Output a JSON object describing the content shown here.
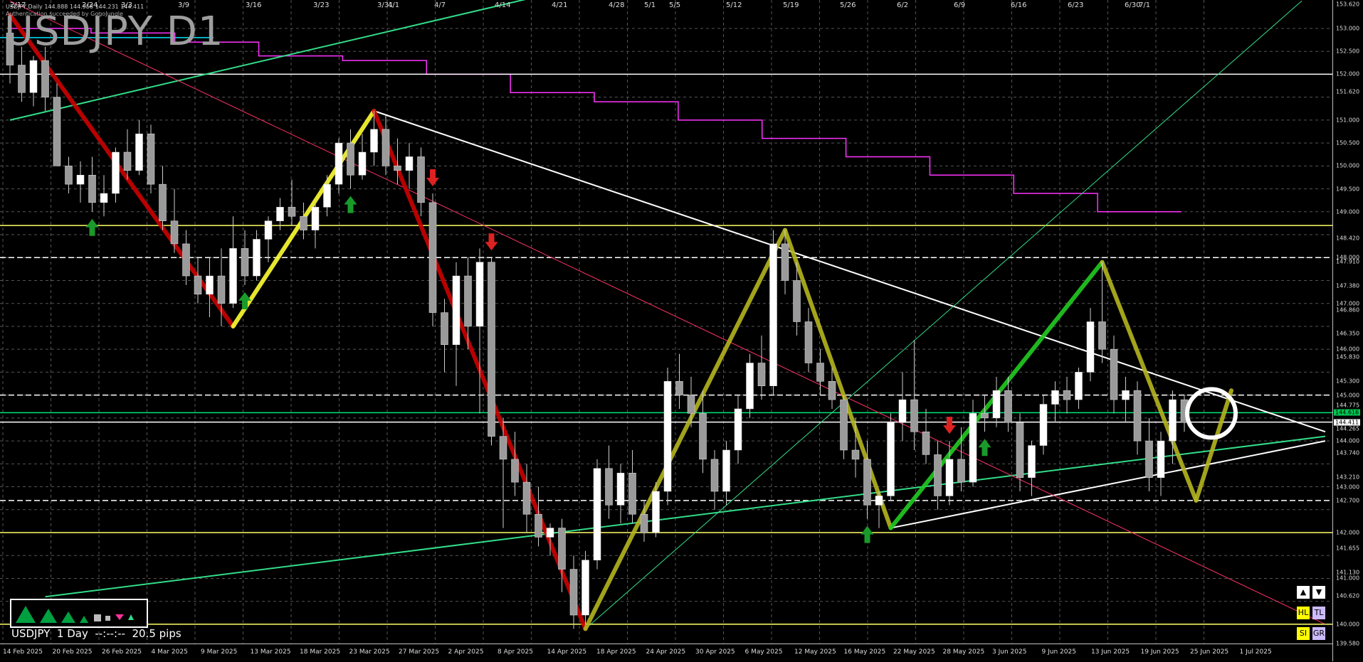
{
  "chart_data": {
    "type": "candlestick",
    "title": "USDJPY D1",
    "header_info": "USDJPY,Daily 144.888 144.958 144.231 144.411",
    "header_info2": "Authentication succeeded by GogoJungle",
    "status": "USDJPY  1 Day  --:--:--  20.5 pips",
    "price_axis": {
      "min": 139.58,
      "max": 153.62,
      "ticks": [
        "153.620",
        "153.000",
        "152.500",
        "152.000",
        "151.620",
        "151.000",
        "150.500",
        "150.000",
        "149.500",
        "149.000",
        "148.420",
        "148.000",
        "147.910",
        "147.380",
        "147.000",
        "146.860",
        "146.350",
        "146.000",
        "145.830",
        "145.300",
        "145.000",
        "144.775",
        "144.265",
        "144.000",
        "143.740",
        "143.210",
        "143.000",
        "142.700",
        "142.000",
        "141.655",
        "141.130",
        "141.000",
        "140.620",
        "140.000",
        "139.580"
      ],
      "current_price": "144.411",
      "green_line_price": "144.616"
    },
    "time_axis_bottom": [
      "14 Feb 2025",
      "20 Feb 2025",
      "26 Feb 2025",
      "4 Mar 2025",
      "9 Mar 2025",
      "13 Mar 2025",
      "18 Mar 2025",
      "23 Mar 2025",
      "27 Mar 2025",
      "2 Apr 2025",
      "8 Apr 2025",
      "14 Apr 2025",
      "18 Apr 2025",
      "24 Apr 2025",
      "30 Apr 2025",
      "6 May 2025",
      "12 May 2025",
      "16 May 2025",
      "22 May 2025",
      "28 May 2025",
      "3 Jun 2025",
      "9 Jun 2025",
      "13 Jun 2025",
      "19 Jun 2025",
      "25 Jun 2025",
      "1 Jul 2025"
    ],
    "time_axis_top": [
      "2/17",
      "2/24",
      "3/3",
      "3/9",
      "3/16",
      "3/23",
      "3/31",
      "4/1",
      "4/7",
      "4/14",
      "4/21",
      "4/28",
      "5/1",
      "5/5",
      "5/12",
      "5/19",
      "5/26",
      "6/2",
      "6/9",
      "6/16",
      "6/23",
      "6/30",
      "7/1"
    ],
    "horizontal_levels": [
      {
        "price": 152.0,
        "color": "#ffffff",
        "style": "solid"
      },
      {
        "price": 148.7,
        "color": "#ffff66",
        "style": "solid"
      },
      {
        "price": 148.0,
        "color": "#ffffff",
        "style": "dashed"
      },
      {
        "price": 145.0,
        "color": "#ffffff",
        "style": "dashed"
      },
      {
        "price": 144.616,
        "color": "#00e676",
        "style": "solid"
      },
      {
        "price": 144.411,
        "color": "#ffffff",
        "style": "solid"
      },
      {
        "price": 142.7,
        "color": "#ffffff",
        "style": "dashed"
      },
      {
        "price": 142.0,
        "color": "#ffff66",
        "style": "solid"
      },
      {
        "price": 140.0,
        "color": "#ffff66",
        "style": "solid"
      }
    ],
    "candles": [
      {
        "o": 152.9,
        "h": 153.3,
        "l": 151.8,
        "c": 152.2
      },
      {
        "o": 152.2,
        "h": 152.6,
        "l": 151.4,
        "c": 151.6
      },
      {
        "o": 151.6,
        "h": 152.4,
        "l": 151.3,
        "c": 152.3
      },
      {
        "o": 152.3,
        "h": 152.6,
        "l": 151.2,
        "c": 151.5
      },
      {
        "o": 151.5,
        "h": 151.8,
        "l": 150.2,
        "c": 150.0
      },
      {
        "o": 150.0,
        "h": 150.2,
        "l": 149.4,
        "c": 149.6
      },
      {
        "o": 149.6,
        "h": 150.1,
        "l": 149.2,
        "c": 149.8
      },
      {
        "o": 149.8,
        "h": 150.2,
        "l": 149.0,
        "c": 149.2
      },
      {
        "o": 149.2,
        "h": 149.8,
        "l": 148.9,
        "c": 149.4
      },
      {
        "o": 149.4,
        "h": 150.4,
        "l": 149.2,
        "c": 150.3
      },
      {
        "o": 150.3,
        "h": 150.8,
        "l": 149.7,
        "c": 149.9
      },
      {
        "o": 149.9,
        "h": 151.0,
        "l": 149.8,
        "c": 150.7
      },
      {
        "o": 150.7,
        "h": 150.9,
        "l": 149.4,
        "c": 149.6
      },
      {
        "o": 149.6,
        "h": 150.0,
        "l": 148.6,
        "c": 148.8
      },
      {
        "o": 148.8,
        "h": 149.5,
        "l": 148.1,
        "c": 148.3
      },
      {
        "o": 148.3,
        "h": 148.6,
        "l": 147.4,
        "c": 147.6
      },
      {
        "o": 147.6,
        "h": 148.0,
        "l": 147.0,
        "c": 147.2
      },
      {
        "o": 147.2,
        "h": 148.0,
        "l": 146.7,
        "c": 147.6
      },
      {
        "o": 147.6,
        "h": 148.2,
        "l": 146.5,
        "c": 147.0
      },
      {
        "o": 147.0,
        "h": 148.9,
        "l": 146.9,
        "c": 148.2
      },
      {
        "o": 148.2,
        "h": 148.6,
        "l": 147.4,
        "c": 147.6
      },
      {
        "o": 147.6,
        "h": 148.6,
        "l": 147.5,
        "c": 148.4
      },
      {
        "o": 148.4,
        "h": 148.9,
        "l": 147.9,
        "c": 148.8
      },
      {
        "o": 148.8,
        "h": 149.3,
        "l": 148.6,
        "c": 149.1
      },
      {
        "o": 149.1,
        "h": 149.7,
        "l": 148.7,
        "c": 148.9
      },
      {
        "o": 148.9,
        "h": 149.2,
        "l": 148.4,
        "c": 148.6
      },
      {
        "o": 148.6,
        "h": 149.2,
        "l": 148.2,
        "c": 149.1
      },
      {
        "o": 149.1,
        "h": 149.8,
        "l": 148.9,
        "c": 149.6
      },
      {
        "o": 149.6,
        "h": 150.6,
        "l": 149.4,
        "c": 150.5
      },
      {
        "o": 150.5,
        "h": 150.8,
        "l": 149.5,
        "c": 149.8
      },
      {
        "o": 149.8,
        "h": 150.7,
        "l": 149.7,
        "c": 150.3
      },
      {
        "o": 150.3,
        "h": 151.2,
        "l": 150.0,
        "c": 150.8
      },
      {
        "o": 150.8,
        "h": 151.1,
        "l": 149.8,
        "c": 150.0
      },
      {
        "o": 150.0,
        "h": 150.6,
        "l": 149.6,
        "c": 149.9
      },
      {
        "o": 149.9,
        "h": 150.5,
        "l": 149.5,
        "c": 150.2
      },
      {
        "o": 150.2,
        "h": 150.4,
        "l": 148.9,
        "c": 149.2
      },
      {
        "o": 149.2,
        "h": 149.4,
        "l": 146.5,
        "c": 146.8
      },
      {
        "o": 146.8,
        "h": 147.1,
        "l": 145.5,
        "c": 146.1
      },
      {
        "o": 146.1,
        "h": 147.9,
        "l": 145.2,
        "c": 147.6
      },
      {
        "o": 147.6,
        "h": 148.0,
        "l": 146.0,
        "c": 146.5
      },
      {
        "o": 146.5,
        "h": 148.2,
        "l": 144.6,
        "c": 147.9
      },
      {
        "o": 147.9,
        "h": 148.0,
        "l": 143.9,
        "c": 144.1
      },
      {
        "o": 144.1,
        "h": 144.5,
        "l": 142.1,
        "c": 143.6
      },
      {
        "o": 143.6,
        "h": 144.2,
        "l": 142.8,
        "c": 143.1
      },
      {
        "o": 143.1,
        "h": 143.5,
        "l": 142.0,
        "c": 142.4
      },
      {
        "o": 142.4,
        "h": 143.0,
        "l": 141.7,
        "c": 141.9
      },
      {
        "o": 141.9,
        "h": 142.2,
        "l": 141.5,
        "c": 142.1
      },
      {
        "o": 142.1,
        "h": 142.3,
        "l": 140.7,
        "c": 141.2
      },
      {
        "o": 141.2,
        "h": 141.5,
        "l": 139.9,
        "c": 140.2
      },
      {
        "o": 140.2,
        "h": 141.6,
        "l": 140.0,
        "c": 141.4
      },
      {
        "o": 141.4,
        "h": 143.6,
        "l": 141.2,
        "c": 143.4
      },
      {
        "o": 143.4,
        "h": 143.9,
        "l": 142.3,
        "c": 142.6
      },
      {
        "o": 142.6,
        "h": 143.5,
        "l": 142.2,
        "c": 143.3
      },
      {
        "o": 143.3,
        "h": 143.8,
        "l": 142.2,
        "c": 142.4
      },
      {
        "o": 142.4,
        "h": 142.7,
        "l": 141.8,
        "c": 142.0
      },
      {
        "o": 142.0,
        "h": 143.1,
        "l": 141.9,
        "c": 142.9
      },
      {
        "o": 142.9,
        "h": 145.6,
        "l": 142.6,
        "c": 145.3
      },
      {
        "o": 145.3,
        "h": 145.9,
        "l": 144.7,
        "c": 145.0
      },
      {
        "o": 145.0,
        "h": 145.4,
        "l": 144.3,
        "c": 144.6
      },
      {
        "o": 144.6,
        "h": 145.1,
        "l": 143.3,
        "c": 143.6
      },
      {
        "o": 143.6,
        "h": 143.8,
        "l": 142.5,
        "c": 142.9
      },
      {
        "o": 142.9,
        "h": 144.0,
        "l": 142.6,
        "c": 143.8
      },
      {
        "o": 143.8,
        "h": 145.0,
        "l": 143.5,
        "c": 144.7
      },
      {
        "o": 144.7,
        "h": 145.9,
        "l": 144.5,
        "c": 145.7
      },
      {
        "o": 145.7,
        "h": 146.3,
        "l": 144.9,
        "c": 145.2
      },
      {
        "o": 145.2,
        "h": 148.6,
        "l": 145.0,
        "c": 148.3
      },
      {
        "o": 148.3,
        "h": 148.6,
        "l": 147.2,
        "c": 147.5
      },
      {
        "o": 147.5,
        "h": 147.9,
        "l": 146.3,
        "c": 146.6
      },
      {
        "o": 146.6,
        "h": 146.9,
        "l": 145.5,
        "c": 145.7
      },
      {
        "o": 145.7,
        "h": 146.0,
        "l": 145.0,
        "c": 145.3
      },
      {
        "o": 145.3,
        "h": 145.6,
        "l": 144.7,
        "c": 144.9
      },
      {
        "o": 144.9,
        "h": 145.0,
        "l": 143.6,
        "c": 143.8
      },
      {
        "o": 143.8,
        "h": 144.5,
        "l": 143.2,
        "c": 143.6
      },
      {
        "o": 143.6,
        "h": 144.0,
        "l": 142.3,
        "c": 142.6
      },
      {
        "o": 142.6,
        "h": 142.9,
        "l": 142.1,
        "c": 142.8
      },
      {
        "o": 142.8,
        "h": 144.6,
        "l": 142.7,
        "c": 144.4
      },
      {
        "o": 144.4,
        "h": 145.5,
        "l": 144.0,
        "c": 144.9
      },
      {
        "o": 144.9,
        "h": 146.2,
        "l": 143.8,
        "c": 144.2
      },
      {
        "o": 144.2,
        "h": 144.7,
        "l": 143.5,
        "c": 143.7
      },
      {
        "o": 143.7,
        "h": 144.0,
        "l": 142.5,
        "c": 142.8
      },
      {
        "o": 142.8,
        "h": 144.0,
        "l": 142.6,
        "c": 143.6
      },
      {
        "o": 143.6,
        "h": 144.3,
        "l": 142.9,
        "c": 143.1
      },
      {
        "o": 143.1,
        "h": 144.9,
        "l": 143.0,
        "c": 144.6
      },
      {
        "o": 144.6,
        "h": 145.0,
        "l": 144.2,
        "c": 144.5
      },
      {
        "o": 144.5,
        "h": 145.4,
        "l": 144.3,
        "c": 145.1
      },
      {
        "o": 145.1,
        "h": 145.4,
        "l": 144.2,
        "c": 144.4
      },
      {
        "o": 144.4,
        "h": 144.6,
        "l": 142.9,
        "c": 143.2
      },
      {
        "o": 143.2,
        "h": 144.0,
        "l": 142.8,
        "c": 143.9
      },
      {
        "o": 143.9,
        "h": 145.0,
        "l": 143.7,
        "c": 144.8
      },
      {
        "o": 144.8,
        "h": 145.3,
        "l": 144.4,
        "c": 145.1
      },
      {
        "o": 145.1,
        "h": 145.4,
        "l": 144.6,
        "c": 144.9
      },
      {
        "o": 144.9,
        "h": 145.6,
        "l": 144.7,
        "c": 145.5
      },
      {
        "o": 145.5,
        "h": 146.9,
        "l": 145.3,
        "c": 146.6
      },
      {
        "o": 146.6,
        "h": 147.9,
        "l": 145.7,
        "c": 146.0
      },
      {
        "o": 146.0,
        "h": 146.3,
        "l": 144.6,
        "c": 144.9
      },
      {
        "o": 144.9,
        "h": 145.4,
        "l": 144.4,
        "c": 145.1
      },
      {
        "o": 145.1,
        "h": 145.3,
        "l": 143.7,
        "c": 144.0
      },
      {
        "o": 144.0,
        "h": 144.5,
        "l": 142.9,
        "c": 143.2
      },
      {
        "o": 143.2,
        "h": 144.2,
        "l": 142.8,
        "c": 144.0
      },
      {
        "o": 144.0,
        "h": 145.1,
        "l": 143.5,
        "c": 144.9
      },
      {
        "o": 144.9,
        "h": 145.0,
        "l": 144.2,
        "c": 144.4
      }
    ],
    "zigzag": [
      {
        "i": 0,
        "p": 153.3,
        "color": "#cc0000"
      },
      {
        "i": 19,
        "p": 146.5,
        "color": "#cc0000"
      },
      {
        "i": 31,
        "p": 151.2,
        "color": "#ffff33"
      },
      {
        "i": 49,
        "p": 139.9,
        "color": "#cc0000"
      },
      {
        "i": 66,
        "p": 148.6,
        "color": "#b5b520"
      },
      {
        "i": 75,
        "p": 142.1,
        "color": "#b5b520"
      },
      {
        "i": 93,
        "p": 147.9,
        "color": "#22cc22"
      },
      {
        "i": 101,
        "p": 142.7,
        "color": "#b5b520"
      },
      {
        "i": 104,
        "p": 145.1,
        "color": "#b5b520"
      }
    ],
    "trend_lines": [
      {
        "from": {
          "i": 31,
          "p": 151.2
        },
        "to": {
          "i": 112,
          "p": 144.2
        },
        "color": "#ffffff",
        "width": 2
      },
      {
        "from": {
          "i": 0,
          "p": 151.0
        },
        "to": {
          "i": 50,
          "p": 154.0
        },
        "color": "#33dd88",
        "width": 2
      },
      {
        "from": {
          "i": 3,
          "p": 140.6
        },
        "to": {
          "i": 112,
          "p": 144.1
        },
        "color": "#33dd88",
        "width": 2
      },
      {
        "from": {
          "i": 75,
          "p": 142.1
        },
        "to": {
          "i": 112,
          "p": 144.0
        },
        "color": "#ffffff",
        "width": 2
      },
      {
        "from": {
          "i": 0,
          "p": 153.6
        },
        "to": {
          "i": 112,
          "p": 140.0
        },
        "color": "#ff3366",
        "width": 1
      },
      {
        "from": {
          "i": 49,
          "p": 139.9
        },
        "to": {
          "i": 110,
          "p": 153.6
        },
        "color": "#33dd88",
        "width": 1
      },
      {
        "from": {
          "i": 49,
          "p": 140.0
        },
        "to": {
          "i": 112,
          "p": 140.0
        },
        "color": "#ffff66",
        "width": 1
      }
    ],
    "magenta_step_line": [
      153.0,
      152.9,
      152.7,
      152.4,
      152.3,
      152.0,
      151.6,
      151.4,
      151.0,
      150.6,
      150.2,
      149.8,
      149.4,
      149.0
    ],
    "cyan_line": {
      "price": 152.8
    }
  },
  "ui": {
    "top_right_buttons": [
      "▲",
      "▼"
    ],
    "bottom_right_buttons": [
      "HL",
      "TL",
      "SI",
      "GR"
    ]
  }
}
